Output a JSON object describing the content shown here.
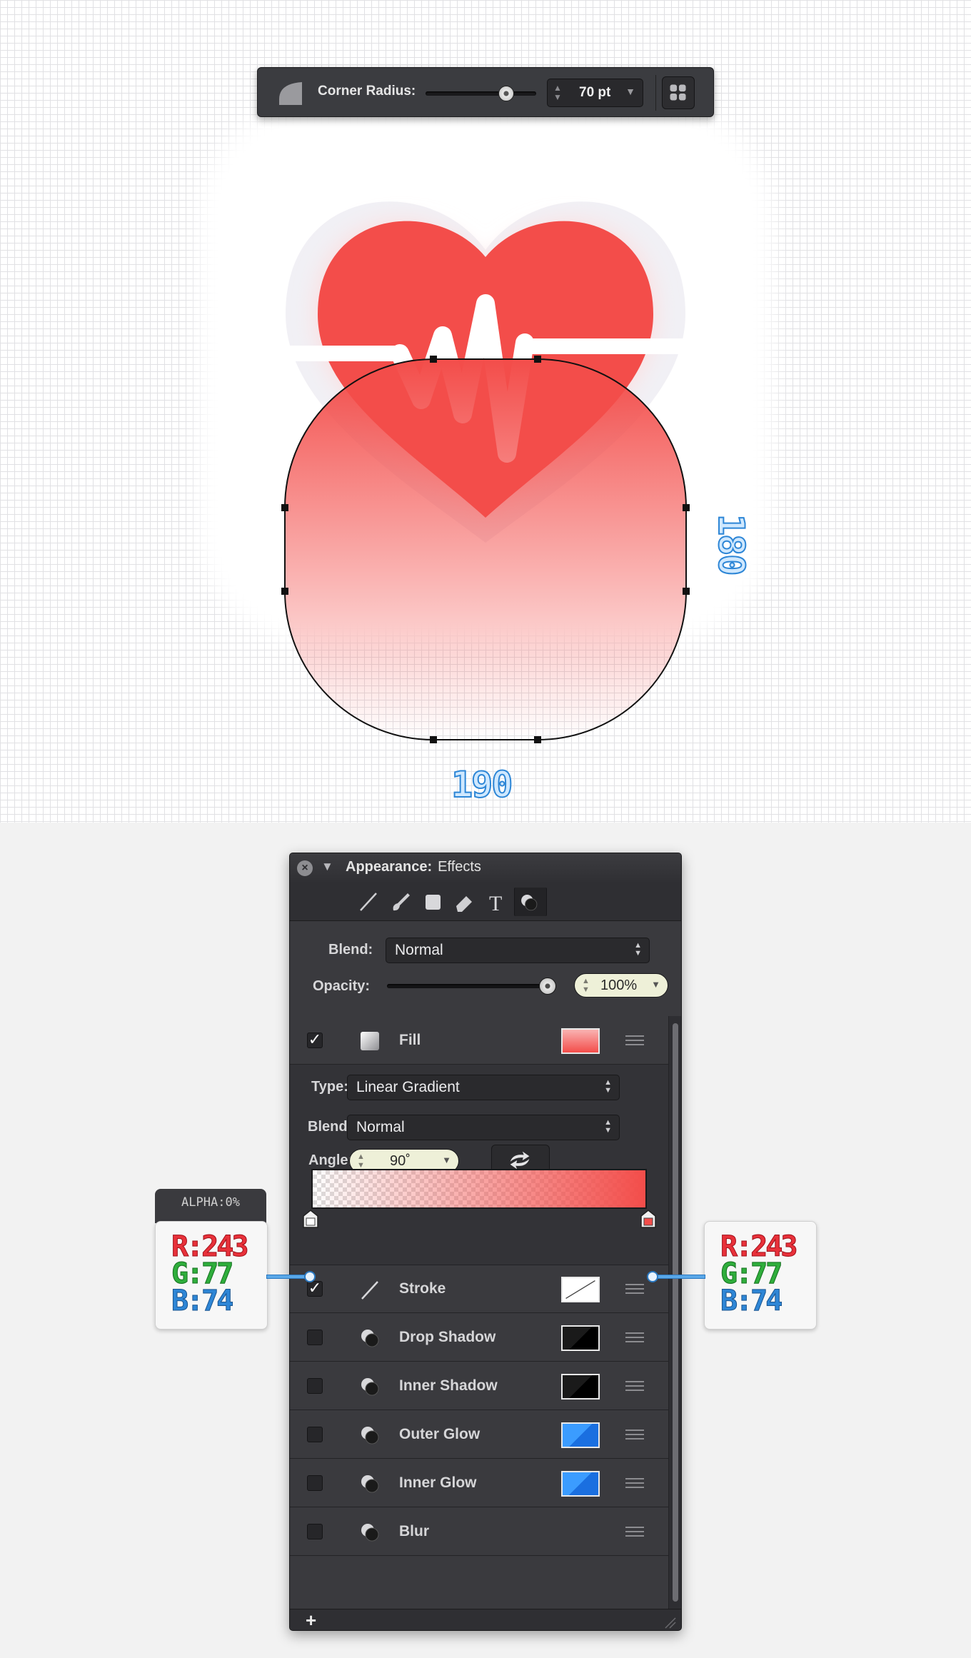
{
  "corner_toolbar": {
    "label": "Corner Radius:",
    "slider_fraction": 0.72,
    "value": "70 pt"
  },
  "dimensions": {
    "width": "190",
    "height": "180"
  },
  "colors": {
    "heart": "#F34D4A",
    "gradient_end": "#F34D4A",
    "panel": "#3A3A3E",
    "dimension_text": "#2D86D6"
  },
  "panel": {
    "title_bold": "Appearance:",
    "title_rest": "Effects",
    "tabs": [
      "line-icon",
      "brush-icon",
      "square-icon",
      "eraser-icon",
      "text-icon",
      "effects-icon"
    ],
    "blend_label": "Blend:",
    "blend_value": "Normal",
    "opacity_label": "Opacity:",
    "opacity_value": "100%",
    "opacity_fraction": 1.0,
    "fill": {
      "label": "Fill",
      "checked": true,
      "type_label": "Type:",
      "type_value": "Linear Gradient",
      "blend_label": "Blend:",
      "blend_value": "Normal",
      "angle_label": "Angle:",
      "angle_value": "90˚"
    },
    "effects": [
      {
        "label": "Stroke",
        "checked": true
      },
      {
        "label": "Drop Shadow",
        "checked": false
      },
      {
        "label": "Inner Shadow",
        "checked": false
      },
      {
        "label": "Outer Glow",
        "checked": false
      },
      {
        "label": "Inner Glow",
        "checked": false
      },
      {
        "label": "Blur",
        "checked": false
      }
    ],
    "add_label": "+"
  },
  "left_callout": {
    "alpha": "ALPHA:0%",
    "r": "R:243",
    "g": "G:77",
    "b": "B:74"
  },
  "right_callout": {
    "r": "R:243",
    "g": "G:77",
    "b": "B:74"
  }
}
